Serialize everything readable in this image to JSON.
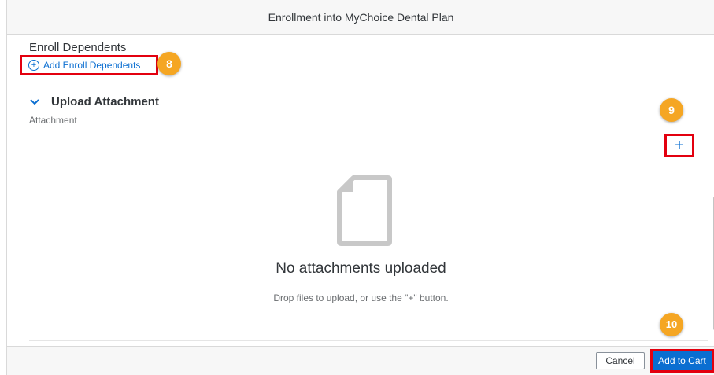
{
  "dialog": {
    "title": "Enrollment into MyChoice Dental Plan"
  },
  "enroll": {
    "section_title": "Enroll Dependents",
    "add_label": "Add Enroll Dependents"
  },
  "upload": {
    "title": "Upload Attachment",
    "field_label": "Attachment",
    "add_button": "+",
    "empty_title": "No attachments uploaded",
    "empty_hint": "Drop files to upload, or use the \"+\" button."
  },
  "footer": {
    "cancel": "Cancel",
    "add_to_cart": "Add to Cart"
  },
  "callouts": [
    "8",
    "9",
    "10"
  ],
  "colors": {
    "accent": "#0a6ed1",
    "highlight": "#e3000f",
    "callout": "#f5a623"
  },
  "icons": [
    "plus-circle-icon",
    "chevron-down-icon",
    "plus-icon",
    "document-icon"
  ]
}
